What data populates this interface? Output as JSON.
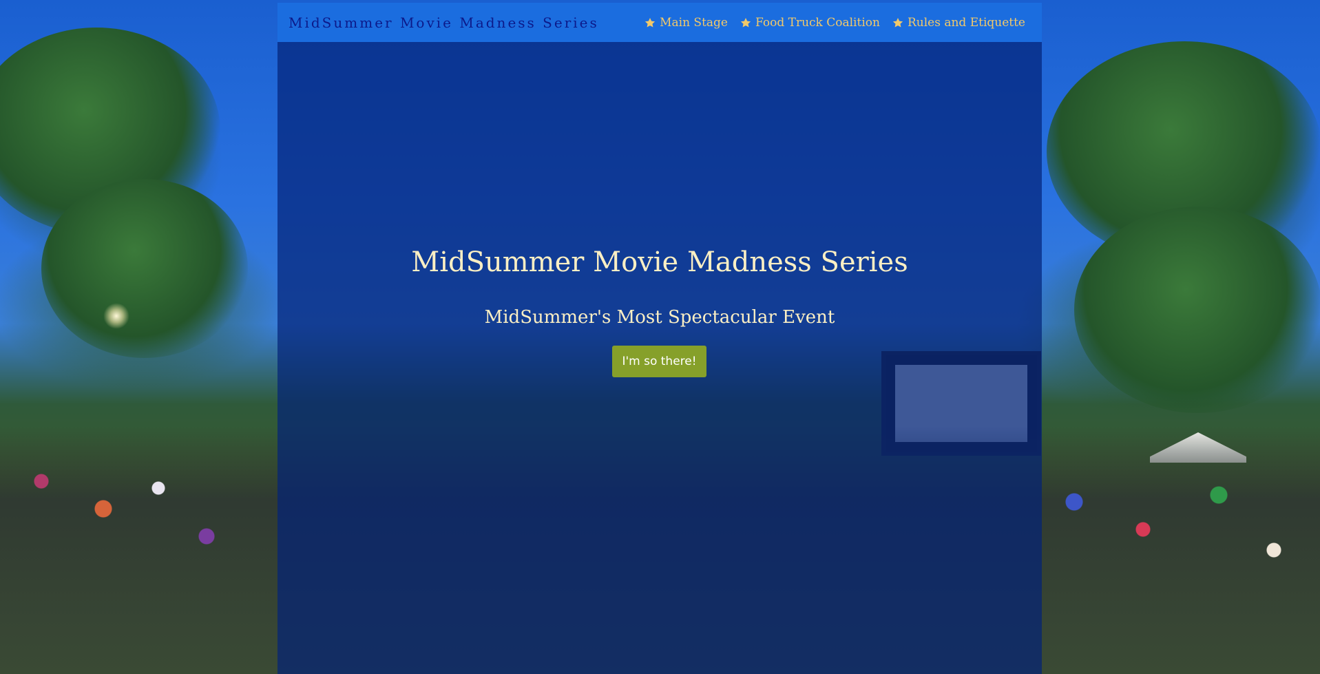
{
  "site": {
    "brand": "MidSummer Movie Madness Series"
  },
  "nav": {
    "icon": "star-icon",
    "icon_color": "#f2c96a",
    "items": [
      {
        "label": "Main Stage"
      },
      {
        "label": "Food Truck Coalition"
      },
      {
        "label": "Rules and Etiquette"
      }
    ]
  },
  "hero": {
    "title": "MidSummer Movie Madness Series",
    "subtitle": "MidSummer's Most Spectacular Event",
    "cta_label": "I'm so there!"
  },
  "colors": {
    "navbar": "#1b6ddf",
    "brand_text": "#0c1a8a",
    "hero_text": "#fbefc4",
    "cta_button": "#86a02a",
    "panel_overlay": "#032278"
  }
}
